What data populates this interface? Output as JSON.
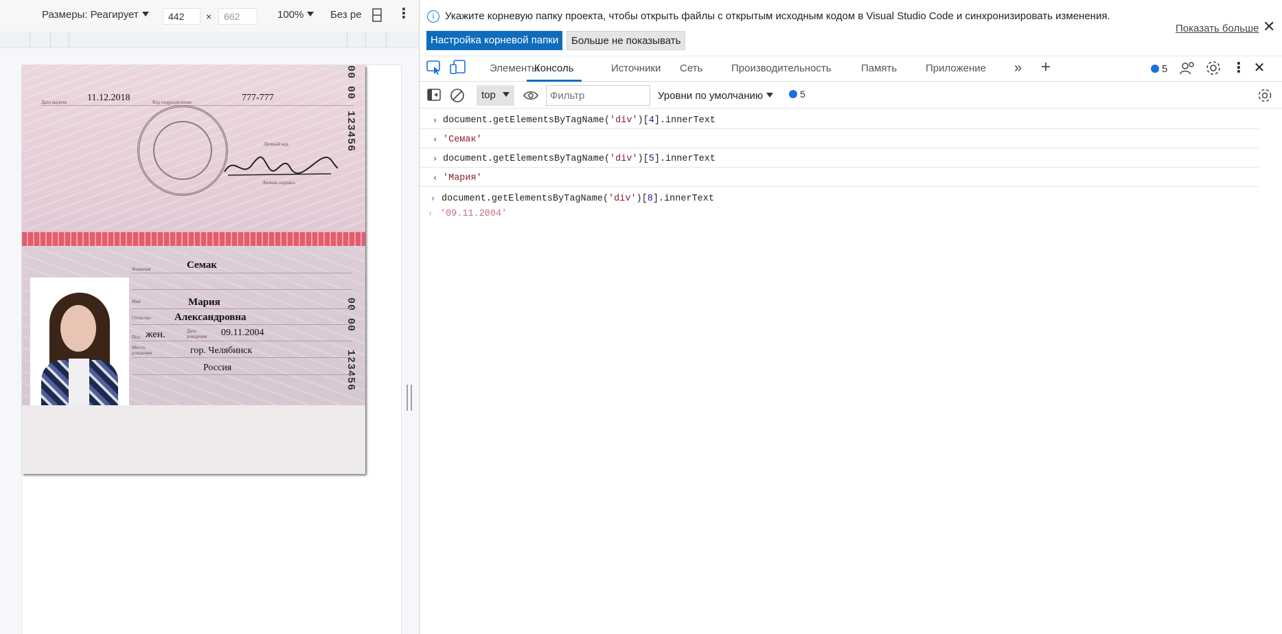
{
  "device_toolbar": {
    "dimensions_label": "Размеры: Реагирует",
    "width_value": "442",
    "times": "×",
    "height_placeholder": "662",
    "zoom": "100%",
    "throttle_label": "Без ре"
  },
  "passport": {
    "issue_date_label": "Дата выдачи",
    "issue_date": "11.12.2018",
    "division_code_label": "Код подразделения",
    "division_code": "777-777",
    "personal_code_label": "Личный код",
    "signature_label": "Личная подпись",
    "signature_text": "Семак",
    "series_top": "00 00",
    "number_top": "123456",
    "series_bottom": "00 00",
    "number_bottom": "123456",
    "surname_label": "Фамилия",
    "surname": "Семак",
    "name_label": "Имя",
    "name": "Мария",
    "patronymic_label": "Отчество",
    "patronymic": "Александровна",
    "sex_label": "Пол",
    "sex": "жен.",
    "birth_date_label": "Дата рождения",
    "birth_date": "09.11.2004",
    "birth_place_label": "Место рождения",
    "birth_city": "гор. Челябинск",
    "birth_country": "Россия"
  },
  "infobar": {
    "message": "Укажите корневую папку проекта, чтобы открыть файлы с открытым исходным кодом в Visual Studio Code и синхронизировать изменения.",
    "setup_button": "Настройка корневой папки",
    "dismiss_button": "Больше не показывать",
    "more_link": "Показать больше"
  },
  "tabs": [
    {
      "label": "Элементы"
    },
    {
      "label": "Консоль"
    },
    {
      "label": "Источники"
    },
    {
      "label": "Сеть"
    },
    {
      "label": "Производительность"
    },
    {
      "label": "Память"
    },
    {
      "label": "Приложение"
    }
  ],
  "issues_count": "5",
  "console_toolbar": {
    "context": "top",
    "filter_placeholder": "Фильтр",
    "levels": "Уровни по умолчанию",
    "message_count": "5"
  },
  "console": {
    "entries": [
      {
        "type": "input",
        "prefix": "document.getElementsByTagName(",
        "arg": "'div'",
        "index_open": ")[",
        "index": "4",
        "suffix": "].innerText"
      },
      {
        "type": "output",
        "value": "'Семак'"
      },
      {
        "type": "input",
        "prefix": "document.getElementsByTagName(",
        "arg": "'div'",
        "index_open": ")[",
        "index": "5",
        "suffix": "].innerText"
      },
      {
        "type": "output",
        "value": "'Мария'"
      },
      {
        "type": "input",
        "prefix": "document.getElementsByTagName(",
        "arg": "'div'",
        "index_open": ")[",
        "index": "8",
        "suffix": "].innerText"
      },
      {
        "type": "output",
        "value": "'09.11.2004'"
      }
    ]
  },
  "colors": {
    "accent": "#0f6cbd",
    "string": "#8a1f2a",
    "stripe": "#e35d6d"
  }
}
